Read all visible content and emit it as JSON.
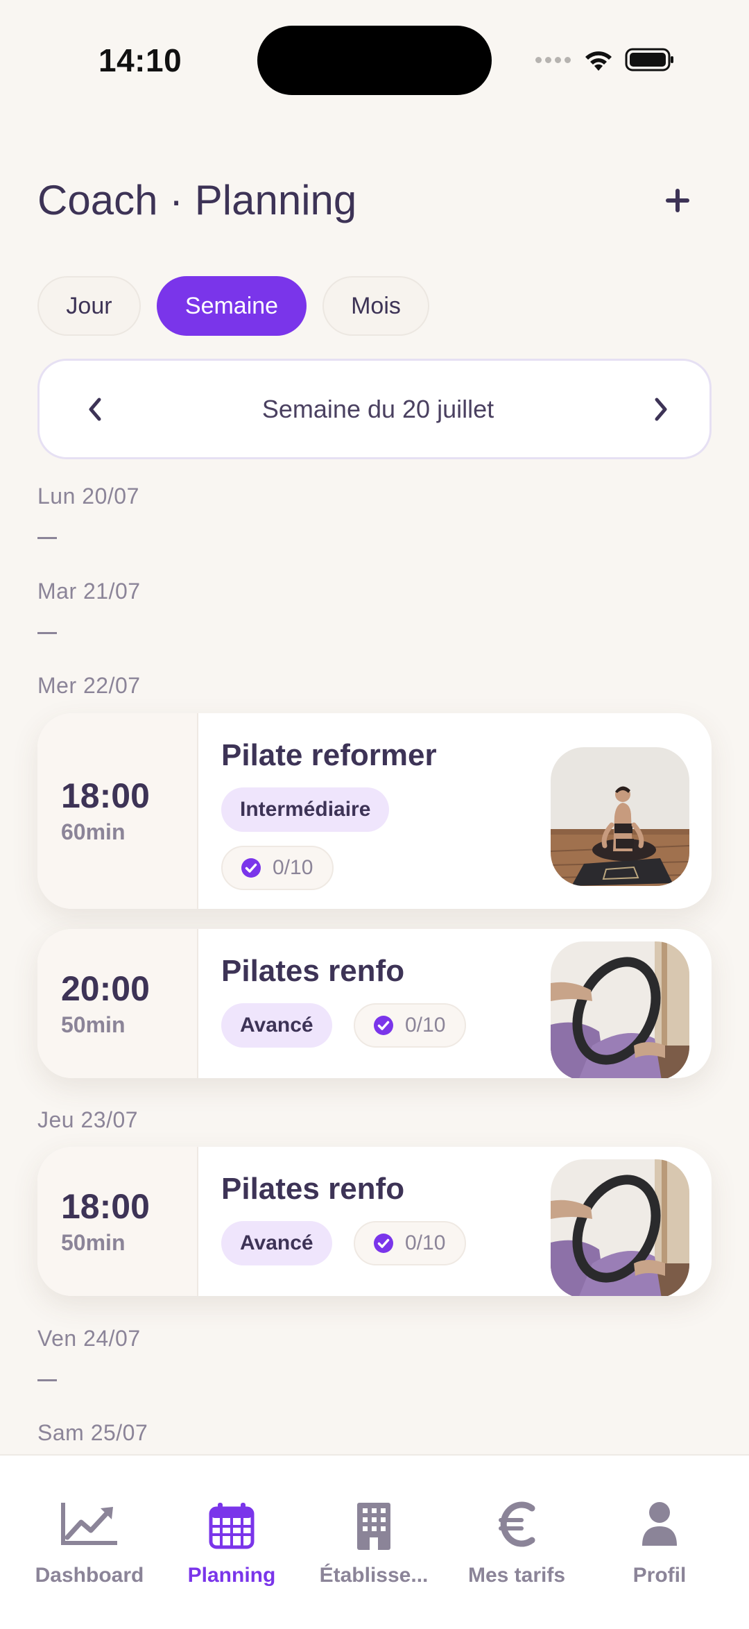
{
  "status_bar": {
    "time": "14:10"
  },
  "header": {
    "title": "Coach · Planning",
    "add_icon": "plus-icon"
  },
  "view_tabs": [
    {
      "label": "Jour",
      "active": false
    },
    {
      "label": "Semaine",
      "active": true
    },
    {
      "label": "Mois",
      "active": false
    }
  ],
  "week_nav": {
    "label": "Semaine du 20 juillet",
    "prev_icon": "chevron-left-icon",
    "next_icon": "chevron-right-icon"
  },
  "days": [
    {
      "label": "Lun 20/07",
      "empty_marker": "—"
    },
    {
      "label": "Mar 21/07",
      "empty_marker": "—"
    },
    {
      "label": "Mer 22/07"
    },
    {
      "label": "Jeu 23/07"
    },
    {
      "label": "Ven 24/07",
      "empty_marker": "—"
    },
    {
      "label": "Sam 25/07"
    }
  ],
  "sessions": [
    {
      "day": "Mer 22/07",
      "time": "18:00",
      "duration": "60min",
      "title": "Pilate reformer",
      "level": "Intermédiaire",
      "bookings": "0/10",
      "image": "woman-meditating-on-mat"
    },
    {
      "day": "Mer 22/07",
      "time": "20:00",
      "duration": "50min",
      "title": "Pilates renfo",
      "level": "Avancé",
      "bookings": "0/10",
      "image": "pilates-ring-exercise"
    },
    {
      "day": "Jeu 23/07",
      "time": "18:00",
      "duration": "50min",
      "title": "Pilates renfo",
      "level": "Avancé",
      "bookings": "0/10",
      "image": "pilates-ring-exercise"
    }
  ],
  "tab_bar": [
    {
      "label": "Dashboard",
      "icon": "chart-line-icon",
      "active": false
    },
    {
      "label": "Planning",
      "icon": "calendar-icon",
      "active": true
    },
    {
      "label": "Établisse...",
      "icon": "building-icon",
      "active": false
    },
    {
      "label": "Mes tarifs",
      "icon": "euro-icon",
      "active": false
    },
    {
      "label": "Profil",
      "icon": "person-icon",
      "active": false
    }
  ],
  "colors": {
    "accent": "#7a35ea",
    "text": "#3d3356",
    "muted": "#8b8498",
    "background": "#f9f6f2",
    "chip": "#efe5fc"
  }
}
